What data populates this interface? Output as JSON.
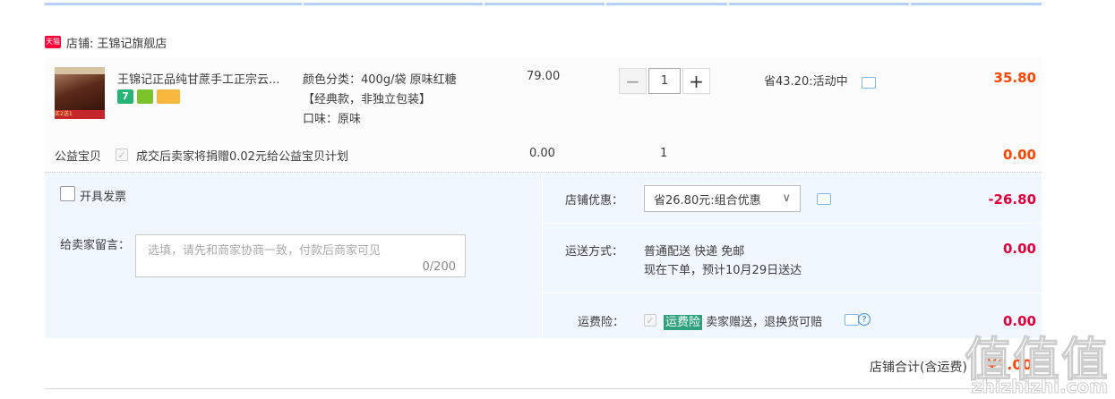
{
  "shop": {
    "badge": "天猫",
    "label": "店铺:",
    "name": "王锦记旗舰店"
  },
  "item": {
    "title": "王锦记正品纯甘蔗手工正宗云...",
    "thumb_text": "买2送1",
    "sku_line1": "颜色分类：400g/袋 原味红糖",
    "sku_line2": "【经典款，非独立包装】",
    "sku_line3": "口味：原味",
    "unit_price": "79.00",
    "qty": "1",
    "minus": "−",
    "plus": "+",
    "promo": "省43.20:活动中",
    "subtotal": "35.80"
  },
  "charity": {
    "label": "公益宝贝",
    "desc": "成交后卖家将捐赠0.02元给公益宝贝计划",
    "price": "0.00",
    "qty": "1",
    "subtotal": "0.00"
  },
  "invoice": {
    "label": "开具发票"
  },
  "message": {
    "label": "给卖家留言：",
    "placeholder": "选填，请先和商家协商一致，付款后商家可见",
    "counter": "0/200"
  },
  "discount": {
    "label": "店铺优惠：",
    "selected": "省26.80元:组合优惠",
    "amount": "-26.80"
  },
  "shipping": {
    "label": "运送方式：",
    "method": "普通配送 快递 免邮",
    "eta": "现在下单，预计10月29日送达",
    "amount": "0.00"
  },
  "insurance": {
    "label": "运费险：",
    "badge": "运费险",
    "desc": "卖家赠送，退换货可赔",
    "amount": "0.00"
  },
  "total": {
    "label": "店铺合计(含运费)",
    "amount": "¥9.00"
  },
  "watermark": {
    "main": "值值值",
    "sub": "zhizhizhi.com"
  },
  "colors": {
    "accent_red": "#ff4400",
    "tmall_red": "#ff0036",
    "insurance_green": "#2fa27d",
    "top_border": "#b2d1ff"
  }
}
